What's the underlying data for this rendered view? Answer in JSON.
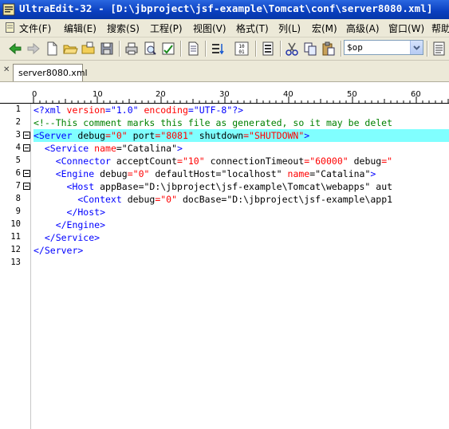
{
  "titlebar": {
    "title": "UltraEdit-32 - [D:\\jbproject\\jsf-example\\Tomcat\\conf\\server8080.xml]"
  },
  "menu": [
    "文件(F)",
    "编辑(E)",
    "搜索(S)",
    "工程(P)",
    "视图(V)",
    "格式(T)",
    "列(L)",
    "宏(M)",
    "高级(A)",
    "窗口(W)",
    "帮助"
  ],
  "toolbar": {
    "icons": [
      "back-arrow-icon",
      "forward-arrow-icon",
      "new-file-icon",
      "open-folder-icon",
      "open-recent-icon",
      "save-icon",
      "print-icon",
      "print-preview-icon",
      "spell-check-icon",
      "page-setup-icon",
      "sort-icon",
      "hex-icon",
      "properties-icon",
      "cut-icon",
      "copy-icon",
      "paste-icon",
      "find-list-icon"
    ],
    "search_value": "$op"
  },
  "tabs": [
    {
      "label": "server8080.xml"
    }
  ],
  "ruler": {
    "labels": [
      "0",
      "10",
      "20",
      "30",
      "40",
      "50",
      "60"
    ]
  },
  "editor": {
    "line_numbers": [
      "1",
      "2",
      "3",
      "4",
      "5",
      "6",
      "7",
      "8",
      "9",
      "10",
      "11",
      "12",
      "13"
    ],
    "highlight_color": "#80ffff",
    "lines": [
      [
        [
          "<?xml ",
          "pi"
        ],
        [
          "version",
          "name"
        ],
        [
          "=\"1.0\" ",
          "pi"
        ],
        [
          "encoding",
          "name"
        ],
        [
          "=\"UTF-8\"?>",
          "pi"
        ]
      ],
      [
        [
          "<!--This comment marks this file as generated, so it may be delet",
          "comment"
        ]
      ],
      [
        [
          "<Server ",
          "tag"
        ],
        [
          "debug",
          "attr"
        ],
        [
          "=\"0\" ",
          "val"
        ],
        [
          "port",
          "attr"
        ],
        [
          "=\"8081\" ",
          "val"
        ],
        [
          "shutdown",
          "attr"
        ],
        [
          "=\"SHUTDOWN\"",
          "val"
        ],
        [
          ">",
          "tag"
        ]
      ],
      [
        [
          "  <Service ",
          "tag"
        ],
        [
          "name",
          "name"
        ],
        [
          "=\"Catalina\"",
          "attr"
        ],
        [
          ">",
          "tag"
        ]
      ],
      [
        [
          "    <Connector ",
          "tag"
        ],
        [
          "acceptCount",
          "attr"
        ],
        [
          "=\"10\" ",
          "val"
        ],
        [
          "connectionTimeout",
          "attr"
        ],
        [
          "=\"60000\" ",
          "val"
        ],
        [
          "debug",
          "attr"
        ],
        [
          "=\"",
          "val"
        ]
      ],
      [
        [
          "    <Engine ",
          "tag"
        ],
        [
          "debug",
          "attr"
        ],
        [
          "=\"0\" ",
          "val"
        ],
        [
          "defaultHost",
          "attr"
        ],
        [
          "=\"localhost\" ",
          "attr"
        ],
        [
          "name",
          "name"
        ],
        [
          "=\"Catalina\"",
          "attr"
        ],
        [
          ">",
          "tag"
        ]
      ],
      [
        [
          "      <Host ",
          "tag"
        ],
        [
          "appBase",
          "attr"
        ],
        [
          "=\"D:\\jbproject\\jsf-example\\Tomcat\\webapps\" aut",
          "attr"
        ]
      ],
      [
        [
          "        <Context ",
          "tag"
        ],
        [
          "debug",
          "attr"
        ],
        [
          "=\"0\" ",
          "val"
        ],
        [
          "docBase",
          "attr"
        ],
        [
          "=\"D:\\jbproject\\jsf-example\\app1",
          "attr"
        ]
      ],
      [
        [
          "      </Host>",
          "tag"
        ]
      ],
      [
        [
          "    </Engine>",
          "tag"
        ]
      ],
      [
        [
          "  </Service>",
          "tag"
        ]
      ],
      [
        [
          "</Server>",
          "tag"
        ]
      ],
      []
    ]
  }
}
